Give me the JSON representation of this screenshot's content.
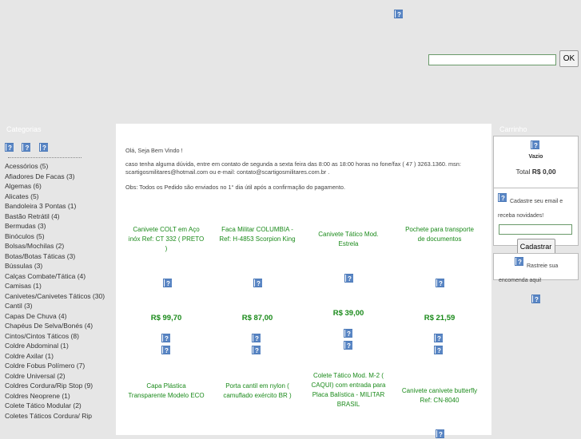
{
  "header": {
    "search_placeholder": "",
    "ok_label": "OK"
  },
  "left": {
    "title": "Categorias",
    "categories": [
      "Acessórios (5)",
      "Afiadores De Facas (3)",
      "Algemas (6)",
      "Alicates (5)",
      "Bandoleira 3 Pontas (1)",
      "Bastão Retrátil (4)",
      "Bermudas (3)",
      "Binóculos (5)",
      "Bolsas/Mochilas (2)",
      "Botas/Botas Táticas (3)",
      "Bússulas (3)",
      "Calças Combate/Tática (4)",
      "Camisas (1)",
      "Canivetes/Canivetes Táticos (30)",
      "Cantil (3)",
      "Capas De Chuva (4)",
      "Chapéus De Selva/Bonés (4)",
      "Cintos/Cintos Táticos (8)",
      "Coldre Abdominal (1)",
      "Coldre Axilar (1)",
      "Coldre Fobus Polímero (7)",
      "Coldre Universal (2)",
      "Coldres Cordura/Rip Stop (9)",
      "Coldres Neoprene (1)",
      "Colete Tático Modular (2)",
      "Coletes Táticos Cordura/ Rip"
    ]
  },
  "center": {
    "greeting": "Olá, Seja Bem Vindo !",
    "contact": "caso tenha alguma dúvida, entre em contato de segunda a sexta feira das 8:00 as 18:00 horas no fone/fax ( 47 ) 3263.1360. msn: scartigosmilitares@hotmail.com ou e-mail: contato@scartigosmilitares.com.br .",
    "obs": "Obs: Todos os Pedido são enviados no 1° dia útil após a confirmação do pagamento.",
    "products": [
      {
        "name": "Canivete COLT em Aço inóx Ref: CT 332 ( PRETO )",
        "price": "R$ 99,70"
      },
      {
        "name": "Faca Militar COLUMBIA - Ref: H-4853 Scorpion King",
        "price": "R$ 87,00"
      },
      {
        "name": "Canivete Tático Mod. Estrela",
        "price": "R$ 39,00"
      },
      {
        "name": "Pochete para transporte de documentos",
        "price": "R$ 21,59"
      },
      {
        "name": "Capa Plástica Transparente Modelo ECO",
        "price": ""
      },
      {
        "name": "Porta cantil em nylon ( camuflado exército BR )",
        "price": ""
      },
      {
        "name": "Colete Tático Mod. M-2 ( CAQUI) com entrada para Placa Balística - MILITAR BRASIL",
        "price": ""
      },
      {
        "name": "Canivete canivete butterfly Ref: CN-8040",
        "price": ""
      }
    ]
  },
  "right": {
    "cart_title": "Carrinho",
    "cart_empty": "Vazio",
    "total_label": "Total",
    "total_value": "R$ 0,00",
    "newsletter_text": "Cadastre seu email e receba novidades!",
    "register_label": "Cadastrar",
    "track_text": "Rastreie sua encomenda aqui!"
  }
}
